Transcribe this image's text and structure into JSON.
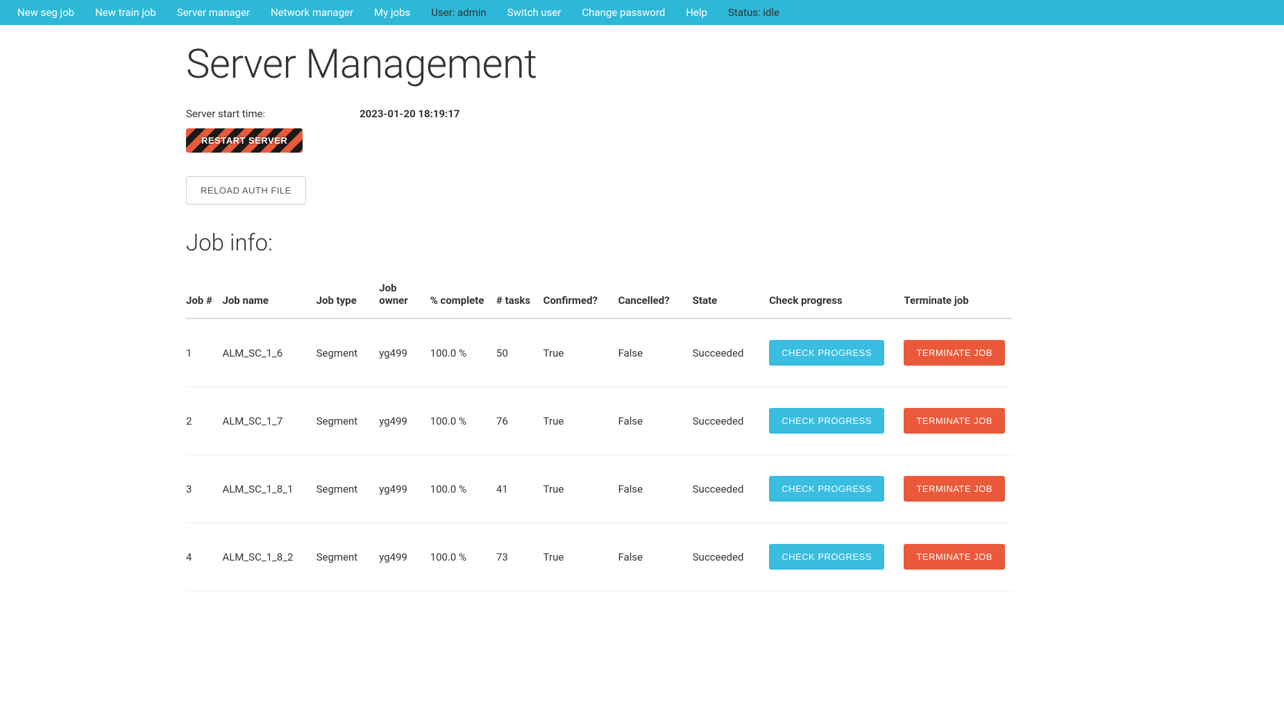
{
  "nav": {
    "links": [
      "New seg job",
      "New train job",
      "Server manager",
      "Network manager",
      "My jobs"
    ],
    "user_label": "User: admin",
    "links2": [
      "Switch user",
      "Change password",
      "Help"
    ],
    "status_label": "Status: idle"
  },
  "page": {
    "title": "Server Management",
    "start_time_label": "Server start time:",
    "start_time_value": "2023-01-20 18:19:17",
    "restart_label": "RESTART SERVER",
    "reload_label": "RELOAD AUTH FILE",
    "job_info_heading": "Job info:"
  },
  "table": {
    "headers": {
      "job_num": "Job #",
      "job_name": "Job name",
      "job_type": "Job type",
      "job_owner": "Job owner",
      "pct_complete": "% complete",
      "num_tasks": "# tasks",
      "confirmed": "Confirmed?",
      "cancelled": "Cancelled?",
      "state": "State",
      "check_progress": "Check progress",
      "terminate_job": "Terminate job"
    },
    "check_button_label": "CHECK PROGRESS",
    "terminate_button_label": "TERMINATE JOB",
    "rows": [
      {
        "num": "1",
        "name": "ALM_SC_1_6",
        "type": "Segment",
        "owner": "yg499",
        "pct": "100.0 %",
        "tasks": "50",
        "confirmed": "True",
        "cancelled": "False",
        "state": "Succeeded"
      },
      {
        "num": "2",
        "name": "ALM_SC_1_7",
        "type": "Segment",
        "owner": "yg499",
        "pct": "100.0 %",
        "tasks": "76",
        "confirmed": "True",
        "cancelled": "False",
        "state": "Succeeded"
      },
      {
        "num": "3",
        "name": "ALM_SC_1_8_1",
        "type": "Segment",
        "owner": "yg499",
        "pct": "100.0 %",
        "tasks": "41",
        "confirmed": "True",
        "cancelled": "False",
        "state": "Succeeded"
      },
      {
        "num": "4",
        "name": "ALM_SC_1_8_2",
        "type": "Segment",
        "owner": "yg499",
        "pct": "100.0 %",
        "tasks": "73",
        "confirmed": "True",
        "cancelled": "False",
        "state": "Succeeded"
      }
    ]
  }
}
